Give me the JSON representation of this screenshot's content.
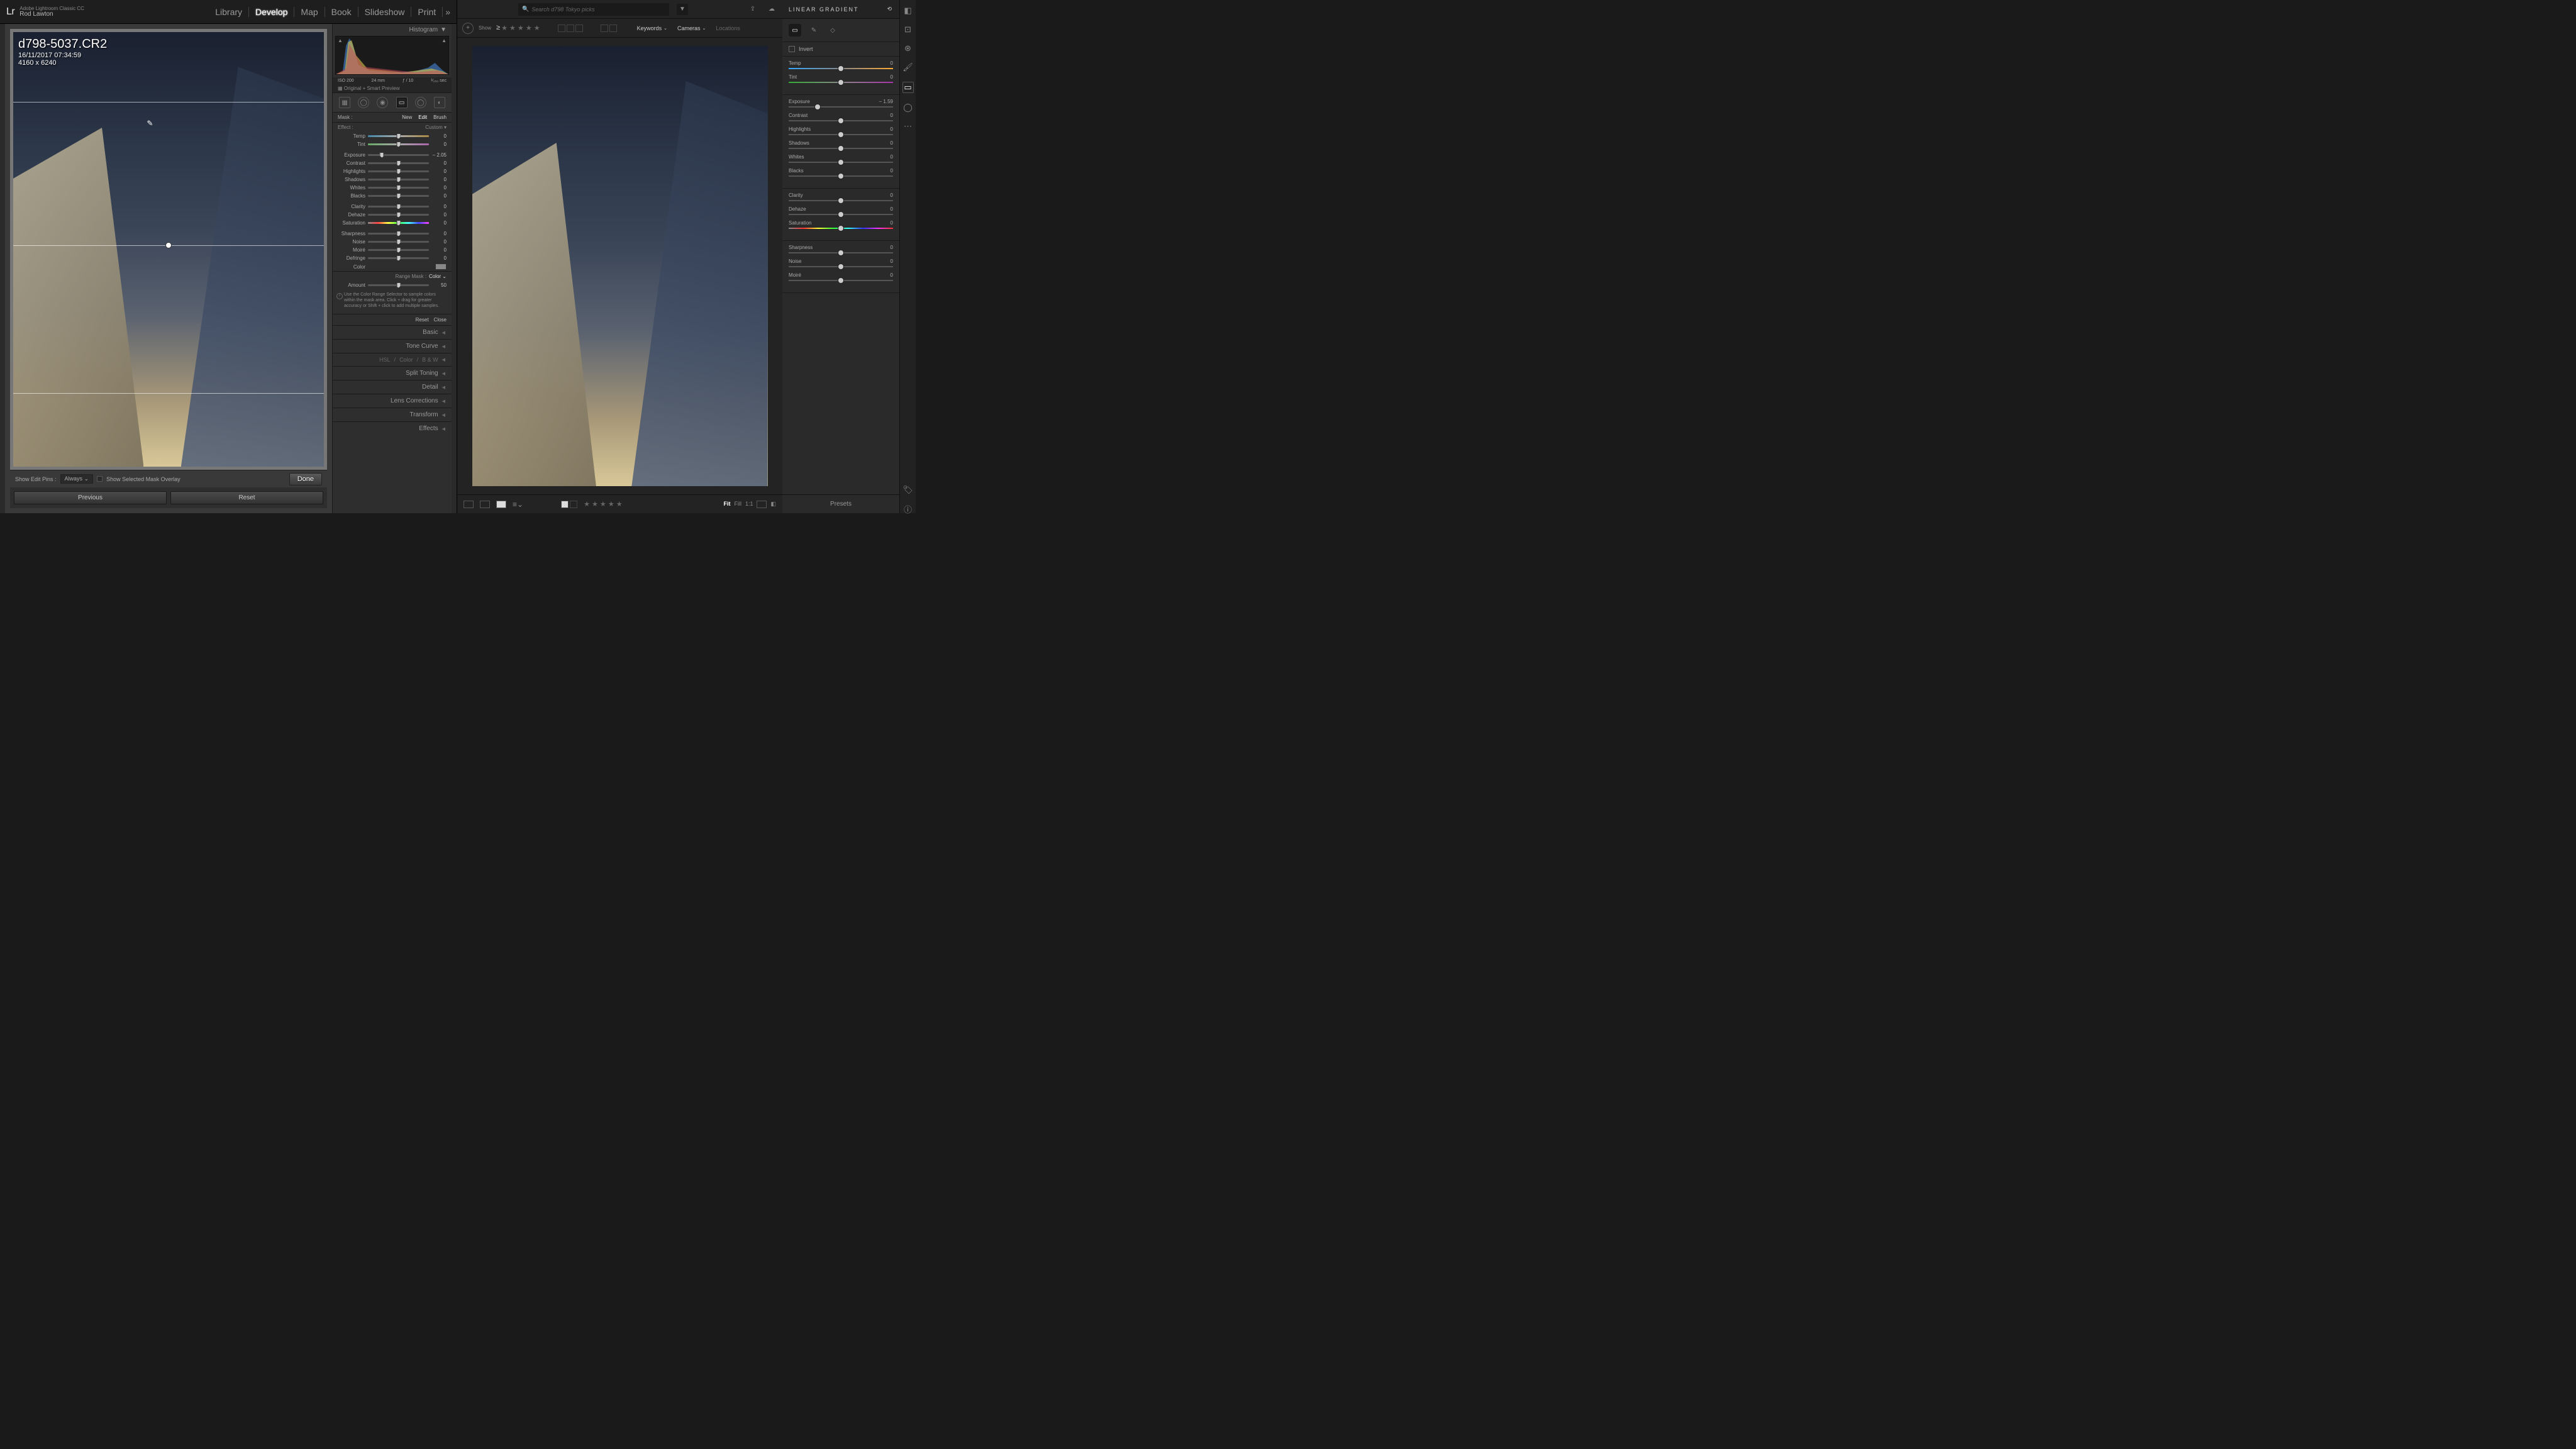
{
  "left": {
    "app_name": "Adobe Lightroom Classic CC",
    "user": "Rod Lawton",
    "logo": "Lr",
    "modules": [
      "Library",
      "Develop",
      "Map",
      "Book",
      "Slideshow",
      "Print"
    ],
    "active_module": "Develop",
    "more_glyph": "»",
    "image": {
      "filename": "d798-5037.CR2",
      "datetime": "16/11/2017 07:34:59",
      "dims": "4160 x 6240"
    },
    "histogram_label": "Histogram",
    "cam": {
      "iso": "ISO 200",
      "focal": "24 mm",
      "aperture": "ƒ / 10",
      "shutter": "¹⁄₂₅₀ sec"
    },
    "preview_label": "Original + Smart Preview",
    "mask_label": "Mask :",
    "mask_new": "New",
    "mask_edit": "Edit",
    "mask_brush": "Brush",
    "effect_label": "Effect :",
    "effect_value": "Custom",
    "sliders": {
      "temp": {
        "label": "Temp",
        "val": "0",
        "pos": 50,
        "cls": "colorful"
      },
      "tint": {
        "label": "Tint",
        "val": "0",
        "pos": 50,
        "cls": "tint"
      },
      "exposure": {
        "label": "Exposure",
        "val": "– 2.05",
        "pos": 23
      },
      "contrast": {
        "label": "Contrast",
        "val": "0",
        "pos": 50
      },
      "highlights": {
        "label": "Highlights",
        "val": "0",
        "pos": 50
      },
      "shadows": {
        "label": "Shadows",
        "val": "0",
        "pos": 50
      },
      "whites": {
        "label": "Whites",
        "val": "0",
        "pos": 50
      },
      "blacks": {
        "label": "Blacks",
        "val": "0",
        "pos": 50
      },
      "clarity": {
        "label": "Clarity",
        "val": "0",
        "pos": 50
      },
      "dehaze": {
        "label": "Dehaze",
        "val": "0",
        "pos": 50
      },
      "saturation": {
        "label": "Saturation",
        "val": "0",
        "pos": 50,
        "cls": "sat"
      },
      "sharpness": {
        "label": "Sharpness",
        "val": "0",
        "pos": 50
      },
      "noise": {
        "label": "Noise",
        "val": "0",
        "pos": 50
      },
      "moire": {
        "label": "Moiré",
        "val": "0",
        "pos": 50
      },
      "defringe": {
        "label": "Defringe",
        "val": "0",
        "pos": 50
      }
    },
    "color_label": "Color",
    "rangemask_label": "Range Mask :",
    "rangemask_value": "Color",
    "amount_label": "Amount",
    "amount_val": "50",
    "help_text": "Use the Color Range Selector to sample colors within the mask area. Click + drag for greater accuracy or Shift + click to add multiple samples.",
    "reset": "Reset",
    "close": "Close",
    "accordions": [
      "Basic",
      "Tone Curve",
      "Split Toning",
      "Detail",
      "Lens Corrections",
      "Transform",
      "Effects"
    ],
    "hsl": {
      "hsl": "HSL",
      "color": "Color",
      "bw": "B & W"
    },
    "prev_btn": "Previous",
    "reset_btn": "Reset",
    "footer": {
      "pins_label": "Show Edit Pins :",
      "pins_val": "Always",
      "overlay": "Show Selected Mask Overlay",
      "done": "Done"
    }
  },
  "right": {
    "search_placeholder": "Search d798 Tokyo picks",
    "show": "Show",
    "keywords": "Keywords",
    "cameras": "Cameras",
    "locations": "Locations",
    "panel_title": "LINEAR GRADIENT",
    "invert": "Invert",
    "sliders": {
      "temp": {
        "label": "Temp",
        "val": "0",
        "pos": 50,
        "cls": "ctemp"
      },
      "tint": {
        "label": "Tint",
        "val": "0",
        "pos": 50,
        "cls": "ctint"
      },
      "exposure": {
        "label": "Exposure",
        "val": "− 1.59",
        "pos": 28
      },
      "contrast": {
        "label": "Contrast",
        "val": "0",
        "pos": 50
      },
      "highlights": {
        "label": "Highlights",
        "val": "0",
        "pos": 50
      },
      "shadows": {
        "label": "Shadows",
        "val": "0",
        "pos": 50
      },
      "whites": {
        "label": "Whites",
        "val": "0",
        "pos": 50
      },
      "blacks": {
        "label": "Blacks",
        "val": "0",
        "pos": 50
      },
      "clarity": {
        "label": "Clarity",
        "val": "0",
        "pos": 50
      },
      "dehaze": {
        "label": "Dehaze",
        "val": "0",
        "pos": 50
      },
      "saturation": {
        "label": "Saturation",
        "val": "0",
        "pos": 50,
        "cls": "csat"
      },
      "sharpness": {
        "label": "Sharpness",
        "val": "0",
        "pos": 50
      },
      "noise": {
        "label": "Noise",
        "val": "0",
        "pos": 50
      },
      "moire": {
        "label": "Moiré",
        "val": "0",
        "pos": 50
      }
    },
    "presets": "Presets",
    "zoom": {
      "fit": "Fit",
      "fill": "Fill",
      "oneone": "1:1"
    }
  }
}
